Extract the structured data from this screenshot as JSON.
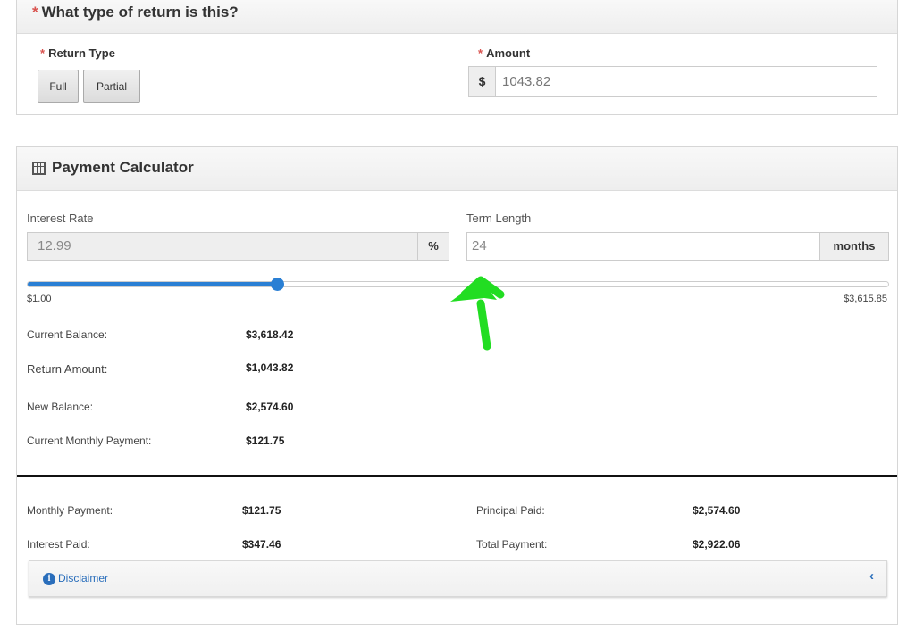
{
  "return_section": {
    "title": "What type of return is this?",
    "required_marker": "*",
    "return_type_label": "Return Type",
    "buttons": {
      "full": "Full",
      "partial": "Partial"
    },
    "amount_label": "Amount",
    "currency_symbol": "$",
    "amount_value": "1043.82"
  },
  "calculator": {
    "title": "Payment Calculator",
    "icon": "calculator-icon",
    "interest_rate_label": "Interest Rate",
    "interest_rate_value": "12.99",
    "interest_rate_unit": "%",
    "term_length_label": "Term Length",
    "term_length_value": "24",
    "term_length_unit": "months",
    "slider": {
      "min_label": "$1.00",
      "max_label": "$3,615.85",
      "fill_fraction": 0.29
    },
    "details": [
      {
        "label": "Current Balance:",
        "value": "$3,618.42"
      },
      {
        "label": "Return Amount:",
        "value": "$1,043.82"
      },
      {
        "label": "New Balance:",
        "value": "$2,574.60"
      },
      {
        "label": "Current Monthly Payment:",
        "value": "$121.75"
      }
    ],
    "summary": {
      "monthly_payment_label": "Monthly Payment:",
      "monthly_payment": "$121.75",
      "principal_paid_label": "Principal Paid:",
      "principal_paid": "$2,574.60",
      "interest_paid_label": "Interest Paid:",
      "interest_paid": "$347.46",
      "total_payment_label": "Total Payment:",
      "total_payment": "$2,922.06"
    },
    "disclaimer": {
      "label": "Disclaimer",
      "icon": "info-icon",
      "toggle_icon": "chevron-left-icon"
    }
  },
  "colors": {
    "accent": "#2a7fd4",
    "required": "#d9534f",
    "annotation_arrow": "#22dd22"
  }
}
